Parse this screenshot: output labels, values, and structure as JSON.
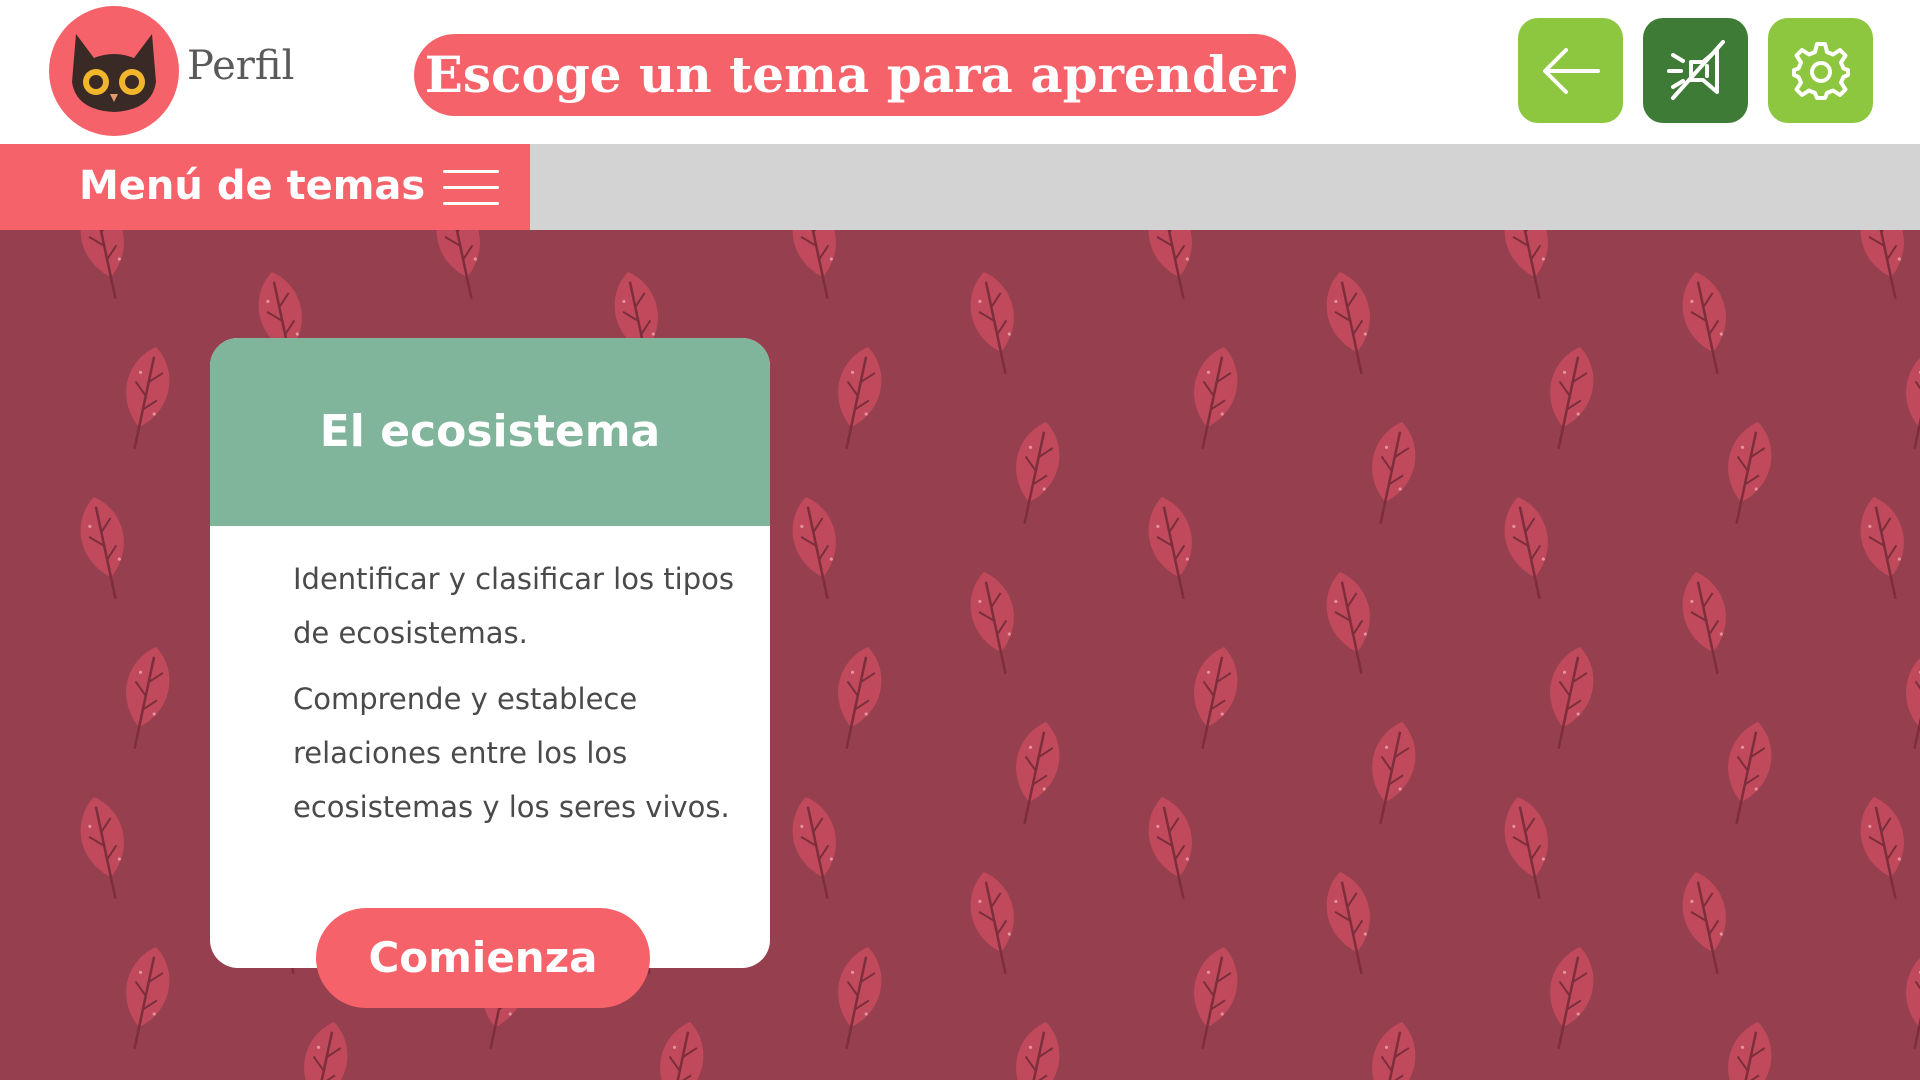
{
  "header": {
    "profile_label": "Perfil",
    "title": "Escoge un tema para aprender",
    "back_icon": "arrow-left-icon",
    "sound_icon": "speaker-muted-icon",
    "settings_icon": "gear-icon",
    "avatar_icon": "owl-icon"
  },
  "menu": {
    "label": "Menú de temas",
    "icon": "hamburger-icon"
  },
  "topic_card": {
    "title": "El ecosistema",
    "objectives": [
      "Identificar y clasificar los tipos de ecosistemas.",
      "Comprende y establece relaciones entre los los ecosistemas y los seres vivos."
    ],
    "start_label": "Comienza"
  },
  "colors": {
    "accent": "#f6626a",
    "green": "#8dc63f",
    "dark_green": "#3e7b36",
    "card_header": "#80b59b",
    "background": "#963f4f",
    "leaf": "#c04a5b",
    "menu_bar": "#d3d3d3"
  }
}
